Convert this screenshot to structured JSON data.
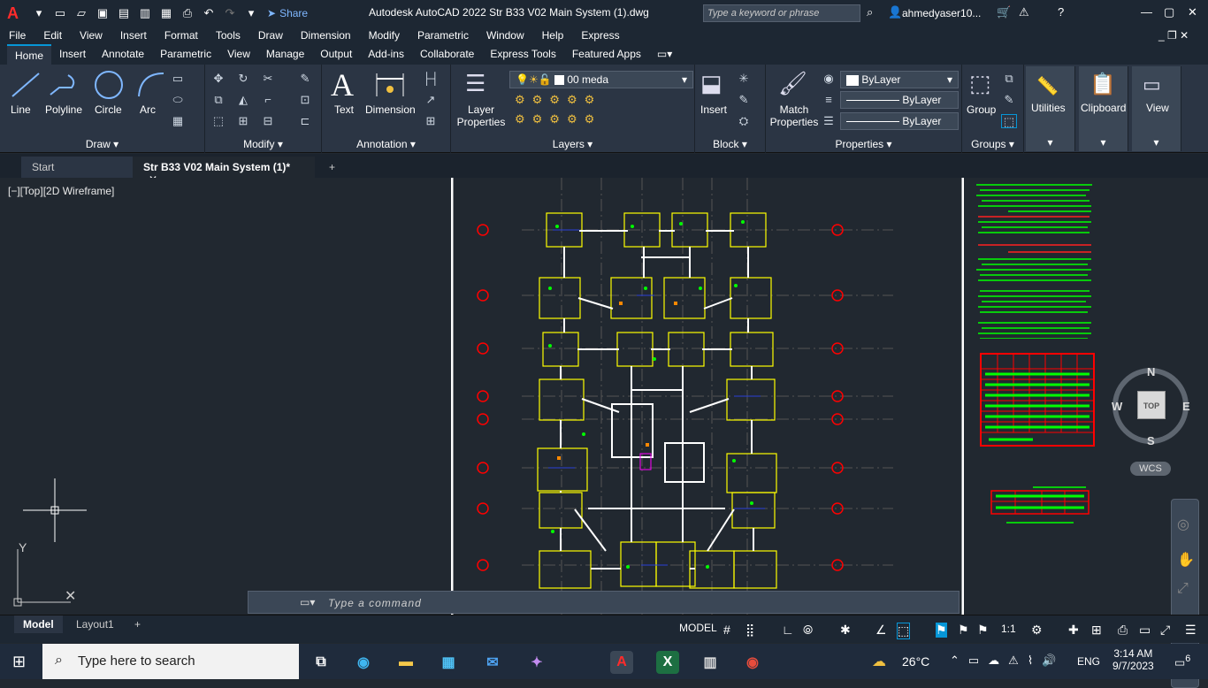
{
  "title_bar": {
    "app_icon": "A",
    "share_label": "Share",
    "doc_title": "Autodesk AutoCAD 2022   Str B33 V02 Main System (1).dwg",
    "search_placeholder": "Type a keyword or phrase",
    "user": "ahmedyaser10..."
  },
  "menu": [
    "File",
    "Edit",
    "View",
    "Insert",
    "Format",
    "Tools",
    "Draw",
    "Dimension",
    "Modify",
    "Parametric",
    "Window",
    "Help",
    "Express"
  ],
  "ribbon_tabs": [
    "Home",
    "Insert",
    "Annotate",
    "Parametric",
    "View",
    "Manage",
    "Output",
    "Add-ins",
    "Collaborate",
    "Express Tools",
    "Featured Apps"
  ],
  "ribbon": {
    "draw": {
      "line": "Line",
      "polyline": "Polyline",
      "circle": "Circle",
      "arc": "Arc",
      "label": "Draw"
    },
    "modify": {
      "label": "Modify"
    },
    "annotation": {
      "text": "Text",
      "dimension": "Dimension",
      "label": "Annotation"
    },
    "layers": {
      "layer_props": "Layer Properties",
      "current_layer": "00 meda",
      "label": "Layers"
    },
    "block": {
      "insert": "Insert",
      "label": "Block"
    },
    "properties": {
      "match": "Match Properties",
      "color": "ByLayer",
      "linetype": "ByLayer",
      "lineweight": "ByLayer",
      "label": "Properties"
    },
    "groups": {
      "group": "Group",
      "label": "Groups"
    },
    "utilities": "Utilities",
    "clipboard": "Clipboard",
    "view": "View"
  },
  "doc_tabs": {
    "start": "Start",
    "active": "Str B33 V02 Main System (1)*"
  },
  "viewport": {
    "label": "[−][Top][2D Wireframe]"
  },
  "navcube": {
    "n": "N",
    "s": "S",
    "e": "E",
    "w": "W",
    "top": "TOP",
    "wcs": "WCS"
  },
  "command": {
    "placeholder": "Type a command"
  },
  "status": {
    "model_tab": "Model",
    "layout1": "Layout1",
    "model_label": "MODEL",
    "scale": "1:1"
  },
  "taskbar": {
    "search": "Type here to search",
    "weather": "26°C",
    "lang": "ENG",
    "time": "3:14 AM",
    "date": "9/7/2023",
    "notif": "6"
  },
  "colors": {
    "accent": "#0696d7",
    "drawing_yellow": "#ffff00",
    "grid_red": "#ff0000",
    "text_green": "#00ff00"
  }
}
